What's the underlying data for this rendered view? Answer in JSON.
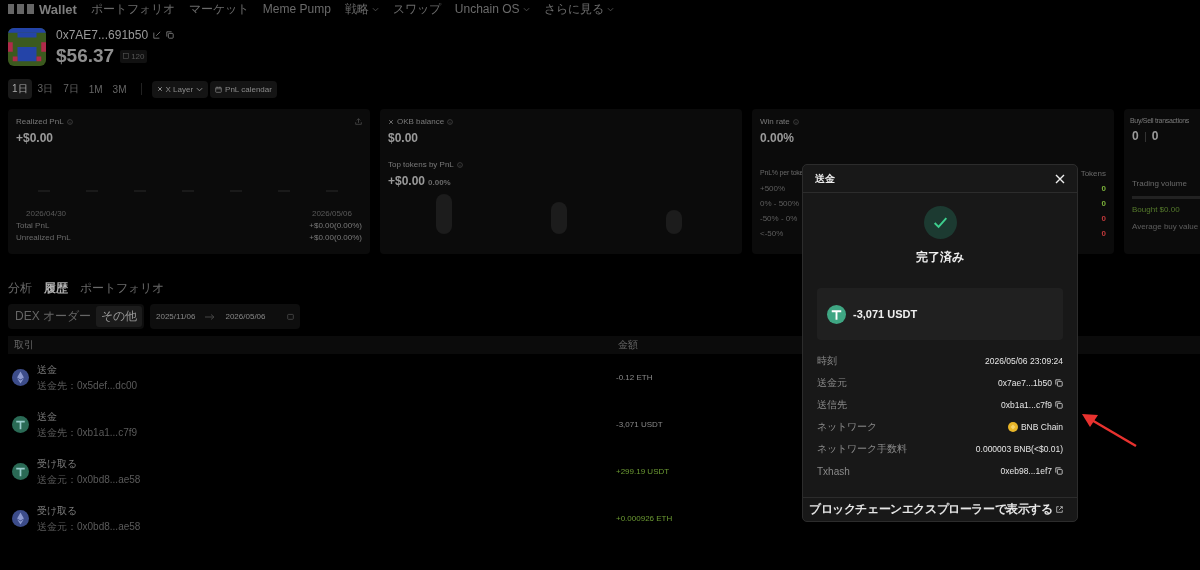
{
  "nav": {
    "logo": "Wallet",
    "items": [
      {
        "label": "ポートフォリオ",
        "dropdown": false
      },
      {
        "label": "マーケット",
        "dropdown": false
      },
      {
        "label": "Meme Pump",
        "dropdown": false
      },
      {
        "label": "戦略",
        "dropdown": true
      },
      {
        "label": "スワップ",
        "dropdown": false
      },
      {
        "label": "Unchain OS",
        "dropdown": true
      },
      {
        "label": "さらに見る",
        "dropdown": true
      }
    ]
  },
  "profile": {
    "address": "0x7AE7...691b50",
    "balance": "$56.37",
    "badge": "120"
  },
  "periods": [
    {
      "label": "1日",
      "selected": true
    },
    {
      "label": "3日",
      "selected": false
    },
    {
      "label": "7日",
      "selected": false
    },
    {
      "label": "1M",
      "selected": false
    },
    {
      "label": "3M",
      "selected": false
    }
  ],
  "chain_filter": "X Layer",
  "calendar_button": "PnL calendar",
  "cards": [
    {
      "kind": "pnl",
      "title": "Realized PnL",
      "value": "+$0.00",
      "dates": [
        "2026/04/30",
        "2026/05/06"
      ],
      "rows": [
        {
          "label": "Total PnL",
          "value": "+$0.00(0.00%)"
        },
        {
          "label": "Unrealized PnL",
          "value": "+$0.00(0.00%)"
        }
      ]
    },
    {
      "kind": "balance",
      "title": "OKB balance",
      "value": "$0.00",
      "subtitle": "Top tokens by PnL",
      "subvalue": "+$0.00",
      "subpct": "0.00%"
    },
    {
      "kind": "winrate",
      "title": "Win rate",
      "value": "0.00%",
      "col_left": "PnL% per toke",
      "col_right": "Tokens",
      "rows": [
        {
          "label": "+500%",
          "value": "0",
          "color": "#7bb23a"
        },
        {
          "label": "0% - 500%",
          "value": "0",
          "color": "#7bb23a"
        },
        {
          "label": "-50% - 0%",
          "value": "0",
          "color": "#c0393b"
        },
        {
          "label": "<-50%",
          "value": "0",
          "color": "#c0393b"
        }
      ]
    },
    {
      "kind": "trades",
      "title": "Buy/Sell transactions",
      "buys": "0",
      "sells": "0",
      "volume_label": "Trading volume",
      "bought": "Bought $0.00",
      "avg": "Average buy value"
    }
  ],
  "section_tabs": [
    {
      "label": "分析",
      "selected": false
    },
    {
      "label": "履歴",
      "selected": true
    },
    {
      "label": "ポートフォリオ",
      "selected": false
    }
  ],
  "order_tabs": [
    {
      "label": "DEX オーダー",
      "selected": false
    },
    {
      "label": "その他",
      "selected": true
    }
  ],
  "date_range": {
    "from": "2025/11/06",
    "to": "2026/05/06"
  },
  "table": {
    "columns": [
      "取引",
      "金額"
    ],
    "rows": [
      {
        "kind": "eth",
        "title": "送金",
        "subtitle": "送金先：0x5def...dc00",
        "amount": "-0.12 ETH",
        "positive": false
      },
      {
        "kind": "usdt",
        "title": "送金",
        "subtitle": "送金先：0xb1a1...c7f9",
        "amount": "-3,071 USDT",
        "positive": false
      },
      {
        "kind": "usdt",
        "title": "受け取る",
        "subtitle": "送金元：0x0bd8...ae58",
        "amount": "+299.19 USDT",
        "positive": true
      },
      {
        "kind": "eth",
        "title": "受け取る",
        "subtitle": "送金元：0x0bd8...ae58",
        "amount": "+0.000926 ETH",
        "positive": true
      }
    ]
  },
  "modal": {
    "title": "送金",
    "status": "完了済み",
    "amount": "-3,071 USDT",
    "details": [
      {
        "kind": "text",
        "label": "時刻",
        "value": "2026/05/06 23:09:24"
      },
      {
        "kind": "address",
        "label": "送金元",
        "value": "0x7ae7...1b50"
      },
      {
        "kind": "address",
        "label": "送信先",
        "value": "0xb1a1...c7f9"
      },
      {
        "kind": "network",
        "label": "ネットワーク",
        "value": "BNB Chain"
      },
      {
        "kind": "text",
        "label": "ネットワーク手数料",
        "value": "0.000003 BNB(<$0.01)"
      },
      {
        "kind": "address",
        "label": "Txhash",
        "value": "0xeb98...1ef7"
      }
    ],
    "link": "ブロックチェーンエクスプローラーで表示する"
  }
}
